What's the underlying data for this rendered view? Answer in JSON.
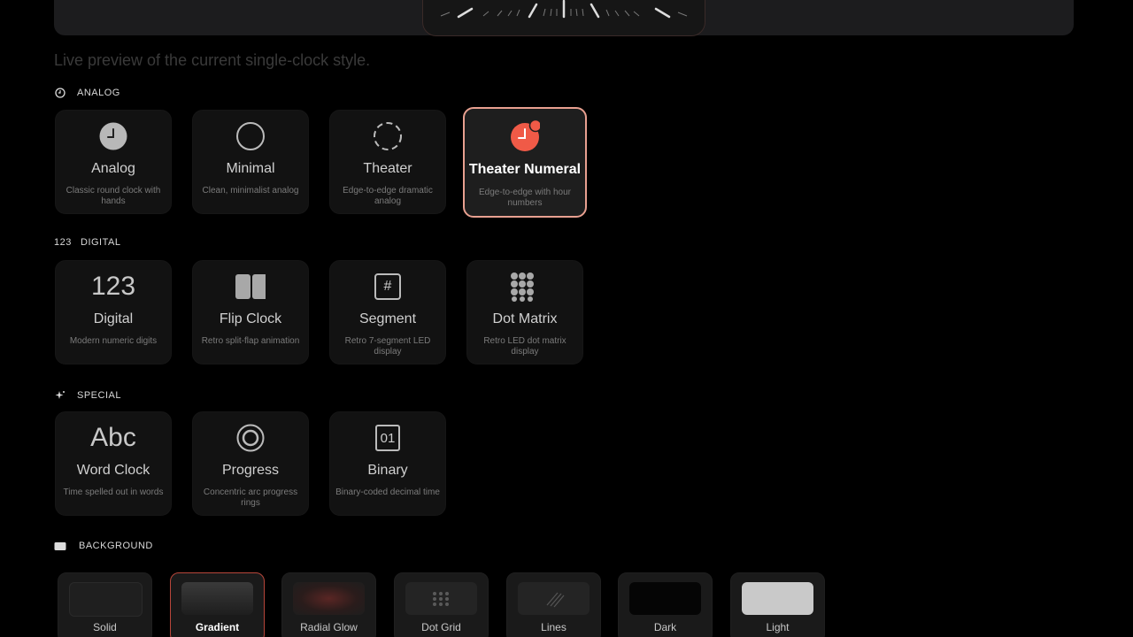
{
  "caption": "Live preview of the current single-clock style.",
  "sections": {
    "analog": {
      "title": "ANALOG"
    },
    "digital": {
      "title": "DIGITAL",
      "icon_text": "123"
    },
    "special": {
      "title": "SPECIAL"
    },
    "background": {
      "title": "BACKGROUND"
    }
  },
  "clock_styles": {
    "analog": {
      "name": "Analog",
      "desc": "Classic round clock with hands"
    },
    "minimal": {
      "name": "Minimal",
      "desc": "Clean, minimalist analog"
    },
    "theater": {
      "name": "Theater",
      "desc": "Edge-to-edge dramatic analog"
    },
    "theater_numeral": {
      "name": "Theater Numeral",
      "desc": "Edge-to-edge with hour numbers"
    },
    "digital": {
      "name": "Digital",
      "desc": "Modern numeric digits",
      "icon_text": "123"
    },
    "flip": {
      "name": "Flip Clock",
      "desc": "Retro split-flap animation"
    },
    "segment": {
      "name": "Segment",
      "desc": "Retro 7-segment LED display",
      "icon_text": "#"
    },
    "dotmatrix": {
      "name": "Dot Matrix",
      "desc": "Retro LED dot matrix display"
    },
    "word": {
      "name": "Word Clock",
      "desc": "Time spelled out in words",
      "icon_text": "Abc"
    },
    "progress": {
      "name": "Progress",
      "desc": "Concentric arc progress rings"
    },
    "binary": {
      "name": "Binary",
      "desc": "Binary-coded decimal time",
      "icon_text": "01"
    }
  },
  "selected_style": "Theater Numeral",
  "backgrounds": [
    {
      "label": "Solid"
    },
    {
      "label": "Gradient"
    },
    {
      "label": "Radial Glow"
    },
    {
      "label": "Dot Grid"
    },
    {
      "label": "Lines"
    },
    {
      "label": "Dark"
    },
    {
      "label": "Light"
    }
  ],
  "selected_background": "Gradient",
  "colors": {
    "accent": "#f05a47",
    "selected_border": "#e8a090"
  }
}
